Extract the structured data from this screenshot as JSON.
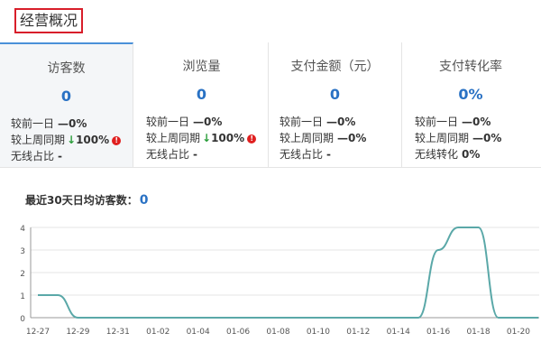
{
  "page_title": "经营概况",
  "stats": [
    {
      "head": "访客数",
      "value": "0",
      "rows": [
        {
          "label": "较前一日",
          "prefix": "—",
          "val": "0%",
          "arrow": false,
          "warn": false
        },
        {
          "label": "较上周同期",
          "prefix": "",
          "val": "100%",
          "arrow": true,
          "warn": true
        },
        {
          "label": "无线占比",
          "prefix": "",
          "val": "-",
          "arrow": false,
          "warn": false
        }
      ]
    },
    {
      "head": "浏览量",
      "value": "0",
      "rows": [
        {
          "label": "较前一日",
          "prefix": "—",
          "val": "0%",
          "arrow": false,
          "warn": false
        },
        {
          "label": "较上周同期",
          "prefix": "",
          "val": "100%",
          "arrow": true,
          "warn": true
        },
        {
          "label": "无线占比",
          "prefix": "",
          "val": "-",
          "arrow": false,
          "warn": false
        }
      ]
    },
    {
      "head": "支付金额（元）",
      "value": "0",
      "rows": [
        {
          "label": "较前一日",
          "prefix": "—",
          "val": "0%",
          "arrow": false,
          "warn": false
        },
        {
          "label": "较上周同期",
          "prefix": "—",
          "val": "0%",
          "arrow": false,
          "warn": false
        },
        {
          "label": "无线占比",
          "prefix": "",
          "val": "-",
          "arrow": false,
          "warn": false
        }
      ]
    },
    {
      "head": "支付转化率",
      "value": "0%",
      "rows": [
        {
          "label": "较前一日",
          "prefix": "—",
          "val": "0%",
          "arrow": false,
          "warn": false
        },
        {
          "label": "较上周同期",
          "prefix": "—",
          "val": "0%",
          "arrow": false,
          "warn": false
        },
        {
          "label": "无线转化",
          "prefix": "",
          "val": "0%",
          "arrow": false,
          "warn": false
        }
      ]
    }
  ],
  "chart_label": "最近30天日均访客数：",
  "chart_avg": "0",
  "chart_data": {
    "type": "line",
    "x": [
      "12-27",
      "12-28",
      "12-29",
      "12-30",
      "12-31",
      "01-01",
      "01-02",
      "01-03",
      "01-04",
      "01-05",
      "01-06",
      "01-07",
      "01-08",
      "01-09",
      "01-10",
      "01-11",
      "01-12",
      "01-13",
      "01-14",
      "01-15",
      "01-16",
      "01-17",
      "01-18",
      "01-19",
      "01-20",
      "01-21"
    ],
    "xticks": [
      "12-27",
      "12-29",
      "12-31",
      "01-02",
      "01-04",
      "01-06",
      "01-08",
      "01-10",
      "01-12",
      "01-14",
      "01-16",
      "01-18",
      "01-20"
    ],
    "series": [
      {
        "values": [
          1,
          1,
          0,
          0,
          0,
          0,
          0,
          0,
          0,
          0,
          0,
          0,
          0,
          0,
          0,
          0,
          0,
          0,
          0,
          0,
          3,
          4,
          4,
          0,
          0,
          0
        ]
      }
    ],
    "yticks": [
      0,
      1,
      2,
      3,
      4
    ],
    "ylim": [
      0,
      4
    ],
    "color": "#5aa8a8"
  }
}
